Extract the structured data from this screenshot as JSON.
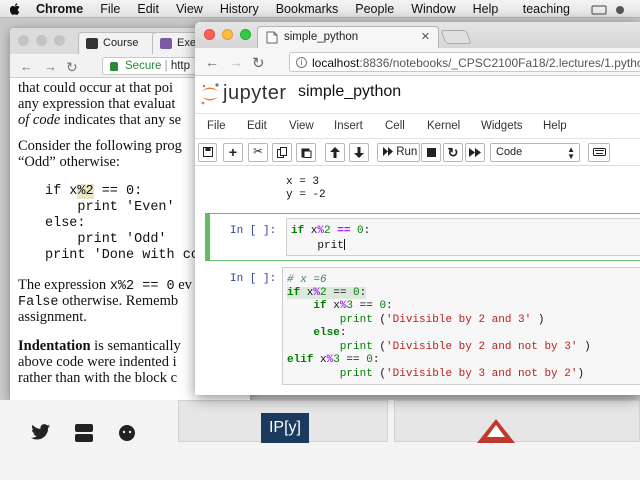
{
  "menubar": {
    "items": [
      "Chrome",
      "File",
      "Edit",
      "View",
      "History",
      "Bookmarks",
      "People",
      "Window",
      "Help"
    ],
    "user": "teaching"
  },
  "bg_window": {
    "tabs": [
      "Course",
      "Exer"
    ],
    "address": {
      "secure": "Secure",
      "url": "http"
    },
    "text": {
      "l1": "that could occur at that poi",
      "l2": "any expression that evaluat",
      "l3": "of code",
      "l3b": " indicates that any se",
      "l4": "Consider the following prog",
      "l5": "“Odd” otherwise:",
      "c1a": "if x",
      "c1b": "%2",
      "c1c": " == 0:",
      "c2": "    print 'Even'",
      "c3": "else:",
      "c4": "    print 'Odd'",
      "c5": "print 'Done with co",
      "l6a": "The expression ",
      "l6b": "x%2 == 0",
      "l6c": " ev",
      "l7a": "False",
      "l7b": " otherwise.  Rememb",
      "l8": "assignment.",
      "l9a": "Indentation",
      "l9b": " is semantically",
      "l10": "above code were indented i",
      "l11": "rather than with the block c"
    }
  },
  "fg_window": {
    "tab_title": "simple_python",
    "address": {
      "host": "localhost",
      "path": ":8836/notebooks/_CPSC2100Fa18/2.lectures/1.python."
    },
    "jupyter_word": "jupyter",
    "notebook_name": "simple_python",
    "menu": [
      "File",
      "Edit",
      "View",
      "Insert",
      "Cell",
      "Kernel",
      "Widgets",
      "Help"
    ],
    "toolbar": {
      "run_label": "Run",
      "cell_type": "Code"
    },
    "cells": {
      "out1": "x = 3",
      "out2": "y = -2",
      "prompt2": "In [ ]:",
      "c2l1a": "if",
      "c2l1b": " x",
      "c2l1c": "%",
      "c2l1d": "2",
      "c2l1e": " ",
      "c2l1f": "==",
      "c2l1g": " ",
      "c2l1h": "0",
      "c2l1i": ":",
      "c2l2": "    prit",
      "prompt3": "In [ ]:",
      "c3l1": "# x =6",
      "c3l2a": "if",
      "c3l2b": " x",
      "c3l2c": "%",
      "c3l2d": "2",
      "c3l2e": " == ",
      "c3l2f": "0",
      "c3l2g": ":",
      "c3l3a": "    if",
      "c3l3b": " x",
      "c3l3c": "%",
      "c3l3d": "3",
      "c3l3e": " == ",
      "c3l3f": "0",
      "c3l3g": ":",
      "c3l4a": "        print",
      "c3l4b": " (",
      "c3l4c": "'Divisible by 2 and 3'",
      "c3l4d": " )",
      "c3l5a": "    else",
      "c3l5b": ":",
      "c3l6a": "        print",
      "c3l6b": " (",
      "c3l6c": "'Divisible by 2 and not by 3'",
      "c3l6d": " )",
      "c3l7a": "elif",
      "c3l7b": " x",
      "c3l7c": "%",
      "c3l7d": "3",
      "c3l7e": " == ",
      "c3l7f": "0",
      "c3l7g": ":",
      "c3l8a": "        print",
      "c3l8b": " (",
      "c3l8c": "'Divisible by 3 and not by 2'",
      "c3l8d": ")"
    }
  },
  "bottom": {
    "panel_text": "IP[y]"
  },
  "colors": {
    "accent": "#f37726",
    "selected_cell": "#66bb6a",
    "prompt": "#303f9f"
  }
}
